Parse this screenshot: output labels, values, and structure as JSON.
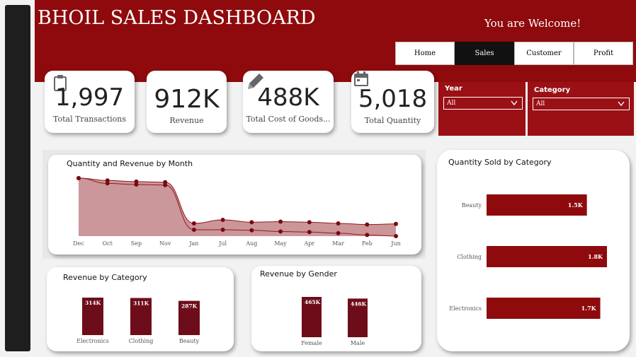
{
  "header": {
    "title": "BHOIL SALES DASHBOARD",
    "welcome": "You are Welcome!",
    "tabs": [
      {
        "label": "Home",
        "active": false
      },
      {
        "label": "Sales",
        "active": true
      },
      {
        "label": "Customer",
        "active": false
      },
      {
        "label": "Profit",
        "active": false
      }
    ]
  },
  "kpis": [
    {
      "value": "1,997",
      "label": "Total Transactions",
      "icon": "clipboard-icon"
    },
    {
      "value": "912K",
      "label": "Revenue",
      "icon": ""
    },
    {
      "value": "488K",
      "label": "Total Cost of Goods...",
      "icon": "pencil-icon"
    },
    {
      "value": "5,018",
      "label": "Total Quantity",
      "icon": "calendar-icon"
    }
  ],
  "slicers": {
    "year": {
      "label": "Year",
      "value": "All"
    },
    "category": {
      "label": "Category",
      "value": "All"
    }
  },
  "colors": {
    "accent": "#8e0a0d",
    "bar": "#8e0a0d",
    "bar_dark": "#6e0d1a",
    "area": "#c38487"
  },
  "chart_data": [
    {
      "type": "area",
      "title": "Quantity and Revenue by Month",
      "categories": [
        "Dec",
        "Oct",
        "Sep",
        "Nov",
        "Jan",
        "Jul",
        "Aug",
        "May",
        "Apr",
        "Mar",
        "Feb",
        "Jun"
      ],
      "series": [
        {
          "values": [
            100,
            96,
            94,
            93,
            22,
            28,
            24,
            25,
            24,
            22,
            20,
            21
          ]
        },
        {
          "values": [
            100,
            91,
            89,
            88,
            11,
            11,
            10,
            8,
            7,
            5,
            2,
            0
          ]
        }
      ],
      "ylim": [
        0,
        100
      ]
    },
    {
      "type": "bar",
      "orientation": "horizontal",
      "title": "Quantity Sold by Category",
      "categories": [
        "Beauty",
        "Clothing",
        "Electronics"
      ],
      "values": [
        1.5,
        1.8,
        1.7
      ],
      "value_labels": [
        "1.5K",
        "1.8K",
        "1.7K"
      ],
      "xlim": [
        0,
        1.8
      ]
    },
    {
      "type": "bar",
      "title": "Revenue by Category",
      "categories": [
        "Electronics",
        "Clothing",
        "Beauty"
      ],
      "values": [
        314,
        311,
        287
      ],
      "value_labels": [
        "314K",
        "311K",
        "287K"
      ]
    },
    {
      "type": "bar",
      "title": "Revenue by Gender",
      "categories": [
        "Female",
        "Male"
      ],
      "values": [
        465,
        446
      ],
      "value_labels": [
        "465K",
        "446K"
      ]
    }
  ]
}
